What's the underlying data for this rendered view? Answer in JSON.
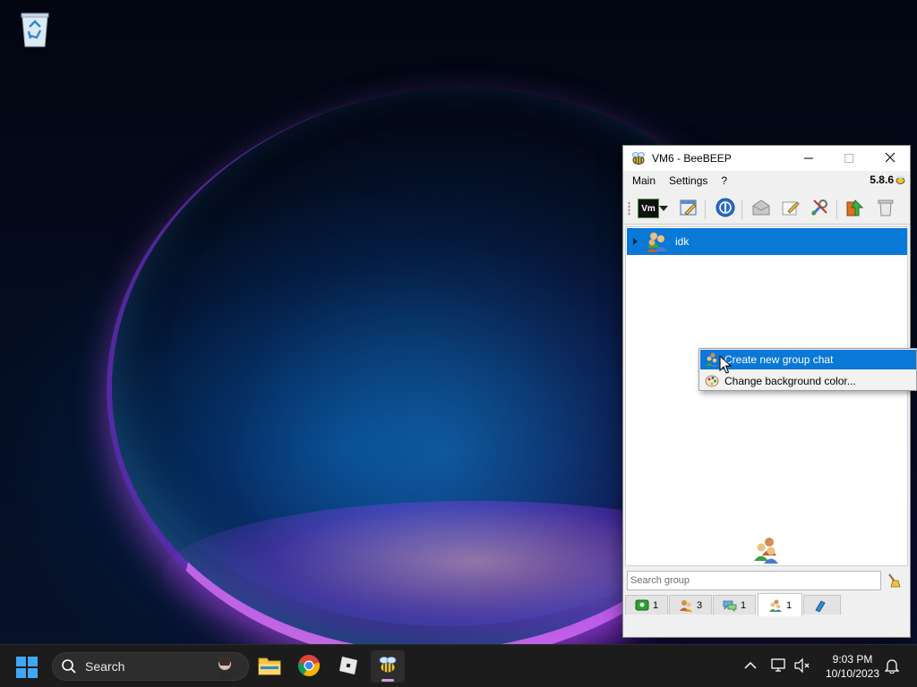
{
  "desktop": {
    "icons": [
      {
        "label": "",
        "icon": "recycle-bin-icon"
      }
    ]
  },
  "window": {
    "title": "VM6 - BeeBEEP",
    "icon": "bee-icon",
    "controls": {
      "minimize": "minimize-icon",
      "maximize": "maximize-icon",
      "close": "close-icon"
    },
    "menu": [
      "Main",
      "Settings",
      "?"
    ],
    "version": "5.8.6",
    "toolbar": {
      "profile_badge": "Vm",
      "buttons": [
        "status-dropdown",
        "edit-profile",
        "network",
        "send-file",
        "write-message",
        "tools",
        "update",
        "delete"
      ]
    },
    "groups": [
      {
        "name": "idk",
        "selected": true,
        "expanded": false
      }
    ],
    "search": {
      "placeholder": "Search group",
      "value": ""
    },
    "tabs": [
      {
        "icon": "users-icon",
        "count": "1",
        "active": false
      },
      {
        "icon": "contacts-icon",
        "count": "3",
        "active": false
      },
      {
        "icon": "chats-icon",
        "count": "1",
        "active": false
      },
      {
        "icon": "groups-icon",
        "count": "1",
        "active": true
      },
      {
        "icon": "files-icon",
        "count": "",
        "active": false
      }
    ]
  },
  "context_menu": {
    "items": [
      {
        "label": "Create new group chat",
        "icon": "group-chat-icon",
        "highlighted": true
      },
      {
        "label": "Change background color...",
        "icon": "palette-icon",
        "highlighted": false
      }
    ]
  },
  "taskbar": {
    "search_label": "Search",
    "apps": [
      "file-explorer",
      "chrome",
      "roblox",
      "beebeep"
    ],
    "active_app": "beebeep",
    "clock": {
      "time": "9:03 PM",
      "date": "10/10/2023"
    }
  },
  "colors": {
    "selection": "#0a78d7",
    "taskbar": "#1c1c1c",
    "window_bg": "#f0f0f0"
  }
}
